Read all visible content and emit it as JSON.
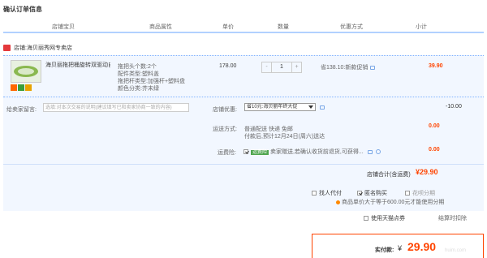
{
  "title": "确认订单信息",
  "header": {
    "shop": "店铺宝贝",
    "attr": "商品属性",
    "price": "单价",
    "qty": "数量",
    "promo": "优惠方式",
    "subtotal": "小计"
  },
  "shop": {
    "label": "店铺:",
    "name": "海贝丽秀网专卖店"
  },
  "item": {
    "name": "海贝丽拖把桶旋转双驱动自动甩...",
    "specs": [
      "拖把头个数:2个",
      "配件类型:塑料盖",
      "拖把杆类型:加强杆+塑料盘",
      "颜色分类:芥末绿"
    ],
    "price": "178.00",
    "quantity": "1",
    "minus": "-",
    "plus": "+",
    "promo": "省138.10:新款促销",
    "subtotal": "39.90"
  },
  "memo": {
    "label": "给卖家留言:",
    "placeholder": "选填:对本次交易的说明(建议填写已和卖家协商一致的内容)"
  },
  "shop_discount": {
    "label": "店铺优惠:",
    "selected": "省10元:海贝丽年终大促",
    "value": "-10.00"
  },
  "shipping": {
    "label": "运送方式:",
    "method": "普通配送 快递 免邮",
    "eta": "付款后,预计12月24日(周六)送达",
    "value": "0.00"
  },
  "insurance": {
    "label": "运费险:",
    "badge": "运费险",
    "text": "卖家赠送,若确认收货前退货,可获得...",
    "value": "0.00"
  },
  "store_total": {
    "label": "店铺合计(含运费)",
    "value": "¥29.90"
  },
  "options": {
    "proxy": "找人代付",
    "anon": "匿名购买",
    "installment": "花呗分期",
    "installment_hint": "商品单价大于等于600.00元才能使用分期"
  },
  "tmall_points": {
    "label": "使用天猫点券",
    "value": "结算时扣除"
  },
  "final": {
    "label": "实付款:",
    "currency": "¥",
    "amount": "29.90"
  },
  "watermark": "huim.com",
  "colors": {
    "accent": "#ff4400",
    "header_border": "#b2d1ff",
    "row_bg": "#f2f7ff"
  }
}
